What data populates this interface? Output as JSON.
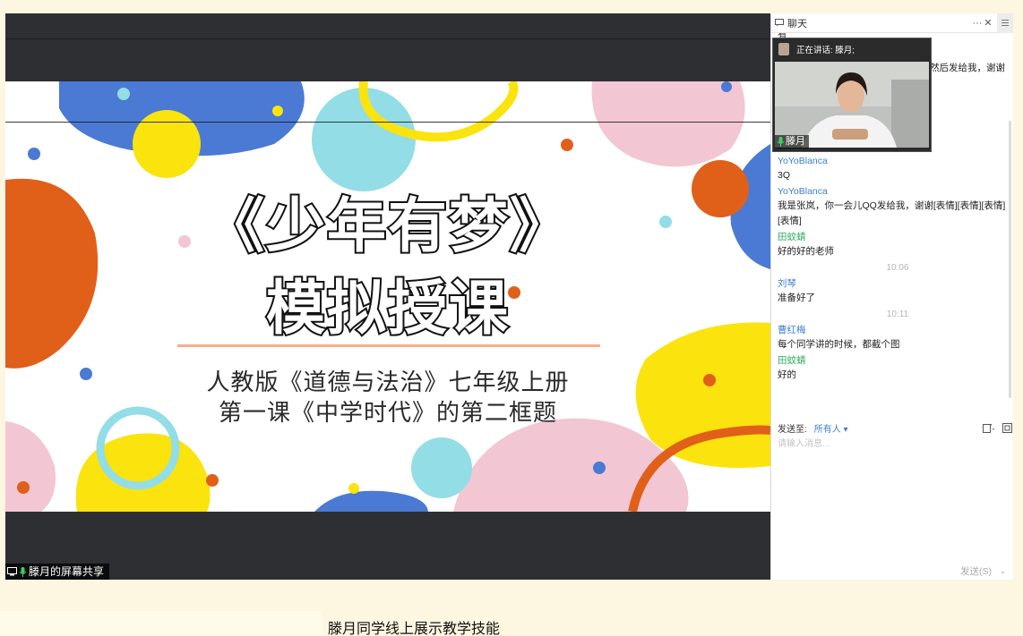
{
  "share": {
    "label": "滕月的屏幕共享",
    "slide": {
      "title": "《少年有梦》",
      "subtitle": "模拟授课",
      "line1": "人教版《道德与法治》七年级上册",
      "line2": "第一课《中学时代》的第二框题"
    }
  },
  "chat": {
    "title": "聊天",
    "header_more": "···",
    "header_close": "✕",
    "speaker": {
      "status": "正在讲话: 滕月;",
      "name": "滕月"
    },
    "messages": [
      {
        "type": "text",
        "text": "有"
      },
      {
        "type": "text",
        "text": "然后发给我，谢谢"
      },
      {
        "type": "sender",
        "name": "YoYoBlanca",
        "color": "blue"
      },
      {
        "type": "text",
        "text": "3Q"
      },
      {
        "type": "sender",
        "name": "YoYoBlanca",
        "color": "blue"
      },
      {
        "type": "text",
        "text": "我是张岚，你一会儿QQ发给我，谢谢[表情][表情][表情][表情]"
      },
      {
        "type": "sender",
        "name": "田蚊蜻",
        "color": "green"
      },
      {
        "type": "text",
        "text": "好的好的老师"
      },
      {
        "type": "time",
        "text": "10:06"
      },
      {
        "type": "sender",
        "name": "刘琴",
        "color": "blue"
      },
      {
        "type": "text",
        "text": "准备好了"
      },
      {
        "type": "time",
        "text": "10:11"
      },
      {
        "type": "sender",
        "name": "曹红梅",
        "color": "blue"
      },
      {
        "type": "text",
        "text": "每个同学讲的时候，都截个图"
      },
      {
        "type": "sender",
        "name": "田蚊蜻",
        "color": "green"
      },
      {
        "type": "text",
        "text": "好的"
      }
    ],
    "send_to_label": "发送至:",
    "send_to_value": "所有人",
    "input_placeholder": "请输入消息...",
    "send_button": "发送(S)"
  },
  "caption": "滕月同学线上展示教学技能",
  "colors": {
    "blue_blob": "#4a7ad4",
    "pink_blob": "#f2c6d3",
    "yellow_blob": "#fbe30d",
    "orange_blob": "#e0601a",
    "cyan_blob": "#93dde6",
    "sender_blue": "#3d7fd0",
    "sender_green": "#2fae60"
  }
}
